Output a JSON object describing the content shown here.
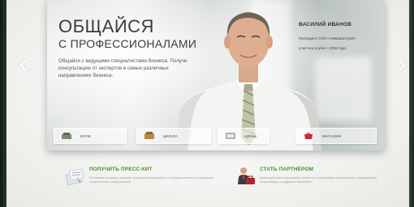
{
  "banner": {
    "headline": "ОБЩАЙСЯ",
    "subheadline": "С ПРОФЕССИОНАЛАМИ",
    "description": "Общайся с ведущими специалистами бизнеса. Получи консультацию от экспертов в самых различных направлениях бизнеса.",
    "person_name": "ВАСИЛИЙ ИВАНОВ",
    "person_role": "Президент ООО «УмМашСтрой»",
    "person_since": "участник клуба с 2008 года"
  },
  "nav": {
    "tabs": [
      {
        "label": "КЛУБ",
        "icon": "club-icon"
      },
      {
        "label": "ШКОЛА",
        "icon": "school-icon"
      },
      {
        "label": "ЦЕНЫ",
        "icon": "prices-icon"
      },
      {
        "label": "МАГАЗИН",
        "icon": "shop-icon"
      }
    ]
  },
  "promos": [
    {
      "title": "ПОЛУЧИТЬ ПРЕСС-КИТ",
      "text": "Рекламная ситуация, ситуация проведения мероприятия, ситуации тренинга, ситуации для ознакомления с информацией.",
      "icon": "press-kit-icon"
    },
    {
      "title": "СТАТЬ ПАРТНЁРОМ",
      "text": "Взаимодействие корпораций и клиентов в организации мероприятий, сотрудничество, консультации и поддержка партнёров.",
      "icon": "partner-icon"
    }
  ],
  "colors": {
    "accent_green": "#4d8a2e",
    "shop_red": "#c8253a"
  }
}
